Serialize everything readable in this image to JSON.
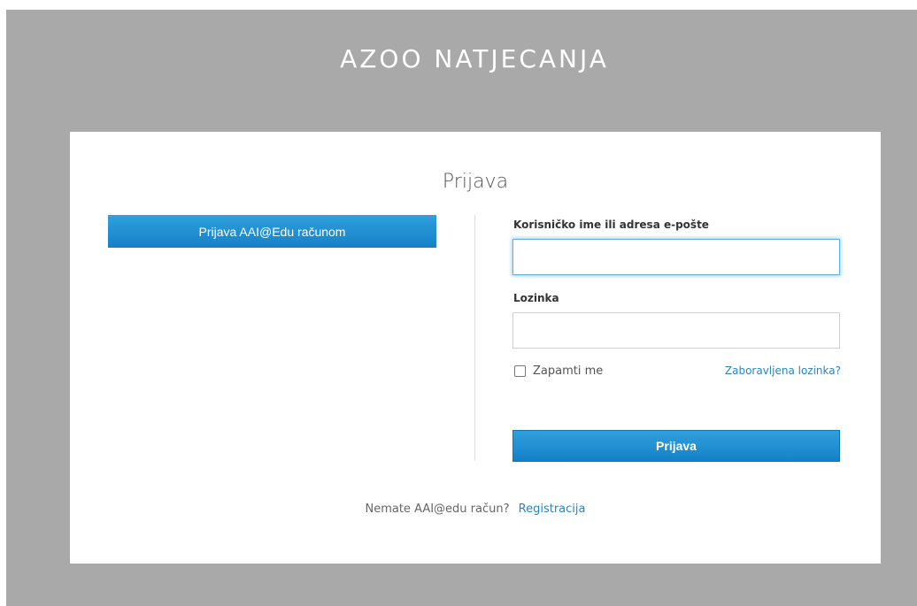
{
  "header": {
    "title": "AZOO NATJECANJA"
  },
  "login": {
    "title": "Prijava",
    "aai_button_label": "Prijava AAI@Edu računom",
    "username_label": "Korisničko ime ili adresa e-pošte",
    "username_value": "",
    "password_label": "Lozinka",
    "password_value": "",
    "remember_label": "Zapamti me",
    "remember_checked": false,
    "forgot_link": "Zaboravljena lozinka?",
    "submit_label": "Prijava",
    "register_prompt": "Nemate AAI@edu račun?",
    "register_link": "Registracija"
  },
  "colors": {
    "background": "#a9a9a9",
    "accent": "#1e8fd2",
    "link": "#2a84c0"
  }
}
